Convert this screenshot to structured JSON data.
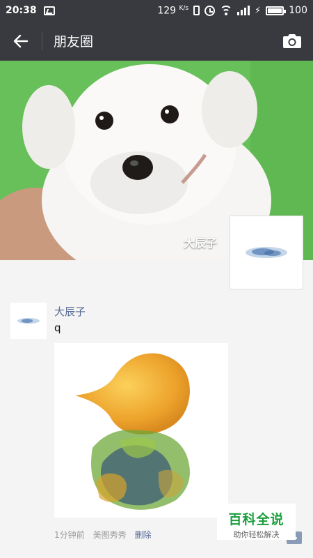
{
  "status_bar": {
    "time": "20:38",
    "network_speed": "129",
    "speed_unit": "K/s",
    "battery": "100"
  },
  "header": {
    "title": "朋友圈",
    "back_icon": "arrow-left-icon",
    "camera_icon": "camera-icon"
  },
  "profile": {
    "name": "大辰子"
  },
  "post": {
    "author": "大辰子",
    "text": "q",
    "time_ago": "1分钟前",
    "source": "美图秀秀",
    "delete_label": "删除"
  },
  "watermark": {
    "main": "百科全说",
    "sub": "助你轻松解决"
  },
  "colors": {
    "header_bg": "#393a3f",
    "link": "#576b95",
    "cover_green": "#67c05a"
  }
}
